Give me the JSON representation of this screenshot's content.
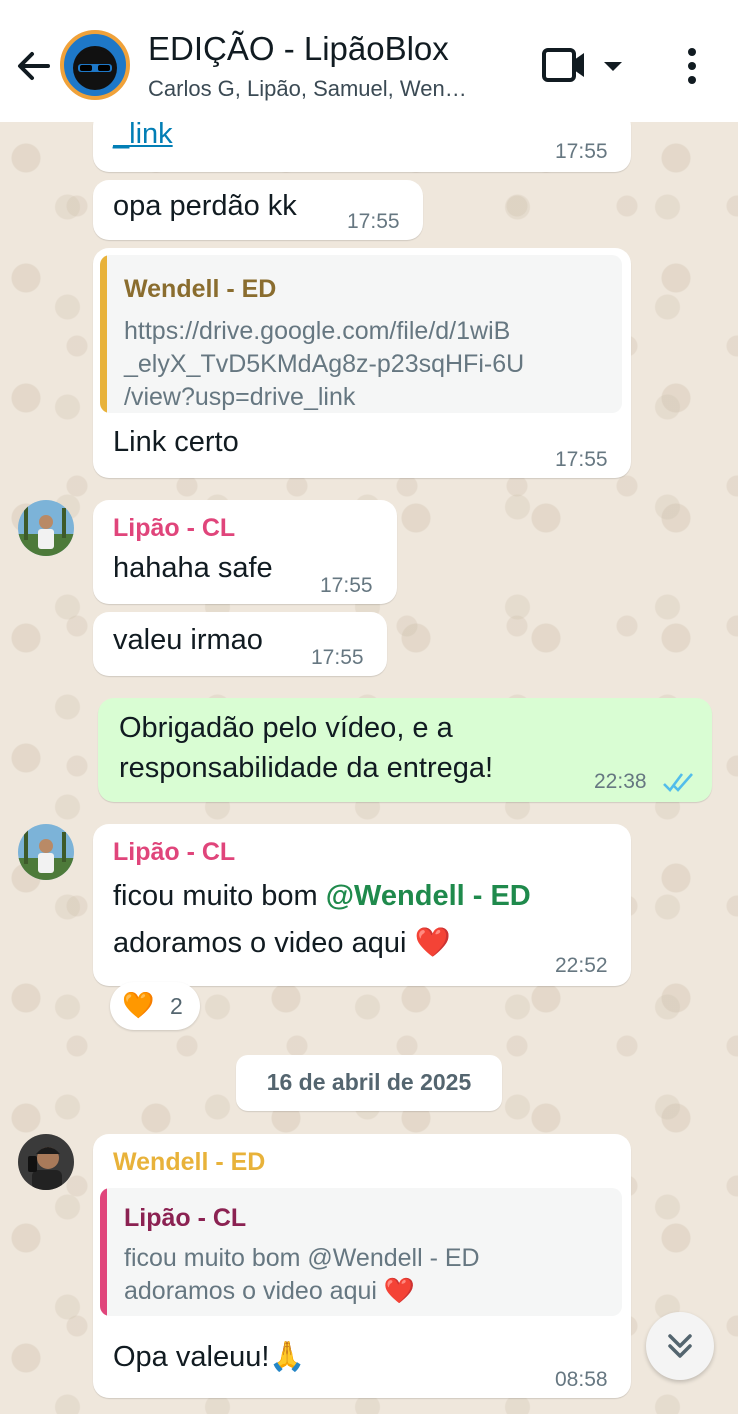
{
  "header": {
    "title": "EDIÇÃO - LipãoBlox",
    "subtitle": "Carlos G, Lipão, Samuel, Wen…"
  },
  "messages": [
    {
      "text": "_link",
      "time": "17:55"
    },
    {
      "text": "opa perdão kk",
      "time": "17:55"
    },
    {
      "quote_author": "Wendell - ED",
      "quote_lines": [
        "https://drive.google.com/file/d/1wiB",
        "_elyX_TvD5KMdAg8z-p23sqHFi-6U",
        "/view?usp=drive_link"
      ],
      "text": "Link certo",
      "time": "17:55"
    },
    {
      "sender": "Lipão - CL",
      "text": "hahaha safe",
      "time": "17:55"
    },
    {
      "text": "valeu irmao",
      "time": "17:55"
    },
    {
      "lines": [
        "Obrigadão pelo vídeo, e a",
        "responsabilidade da entrega!"
      ],
      "time": "22:38"
    },
    {
      "sender": "Lipão - CL",
      "line1_prefix": "ficou muito bom ",
      "mention": "@Wendell - ED",
      "line2": "adoramos o video aqui",
      "emoji": "❤️",
      "time": "22:52",
      "reaction_emoji": "🧡",
      "reaction_count": "2"
    },
    {
      "sender": "Wendell - ED",
      "quote_author": "Lipão - CL",
      "quote_lines": [
        "ficou muito bom @Wendell - ED",
        "adoramos o video aqui ❤️"
      ],
      "text": "Opa valeuu!",
      "emoji": "🙏",
      "time": "08:58"
    }
  ],
  "date_separator": "16 de abril de 2025",
  "colors": {
    "sender_lipao": "#e0457b",
    "sender_wendell": "#e8b23a",
    "quote_wendell": "#8a6d2f",
    "quote_lipao": "#8b2252",
    "mention": "#1f8a4c",
    "read_ticks": "#53bdeb"
  }
}
